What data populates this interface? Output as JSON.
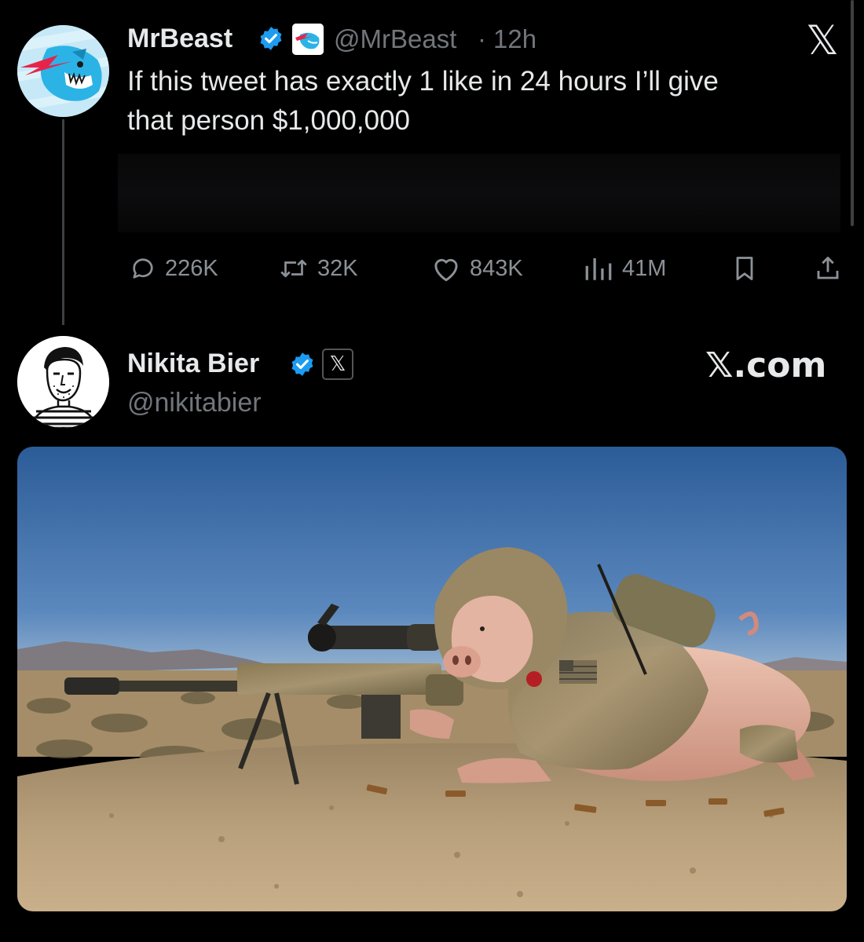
{
  "tweet": {
    "author_name": "MrBeast",
    "handle": "@MrBeast",
    "separator": "·",
    "time": "12h",
    "text_line1": "If this tweet has exactly 1 like in 24 hours I’ll give",
    "text_line2": "that person $1,000,000",
    "x_logo": "𝕏",
    "stats": {
      "replies": "226K",
      "reposts": "32K",
      "likes": "843K",
      "views": "41M"
    },
    "icons": {
      "reply": "reply-icon",
      "repost": "repost-icon",
      "like": "heart-icon",
      "views": "views-icon",
      "bookmark": "bookmark-icon",
      "share": "share-icon"
    }
  },
  "reply": {
    "author_name": "Nikita Bier",
    "handle": "@nikitabier",
    "site_label": "𝕏.com",
    "x_badge": "𝕏"
  },
  "colors": {
    "background": "#000000",
    "text": "#e7e9ea",
    "muted": "#71767b",
    "verified_blue": "#1d9bf0",
    "sky": "#3f6fa8",
    "desert": "#b39673"
  }
}
